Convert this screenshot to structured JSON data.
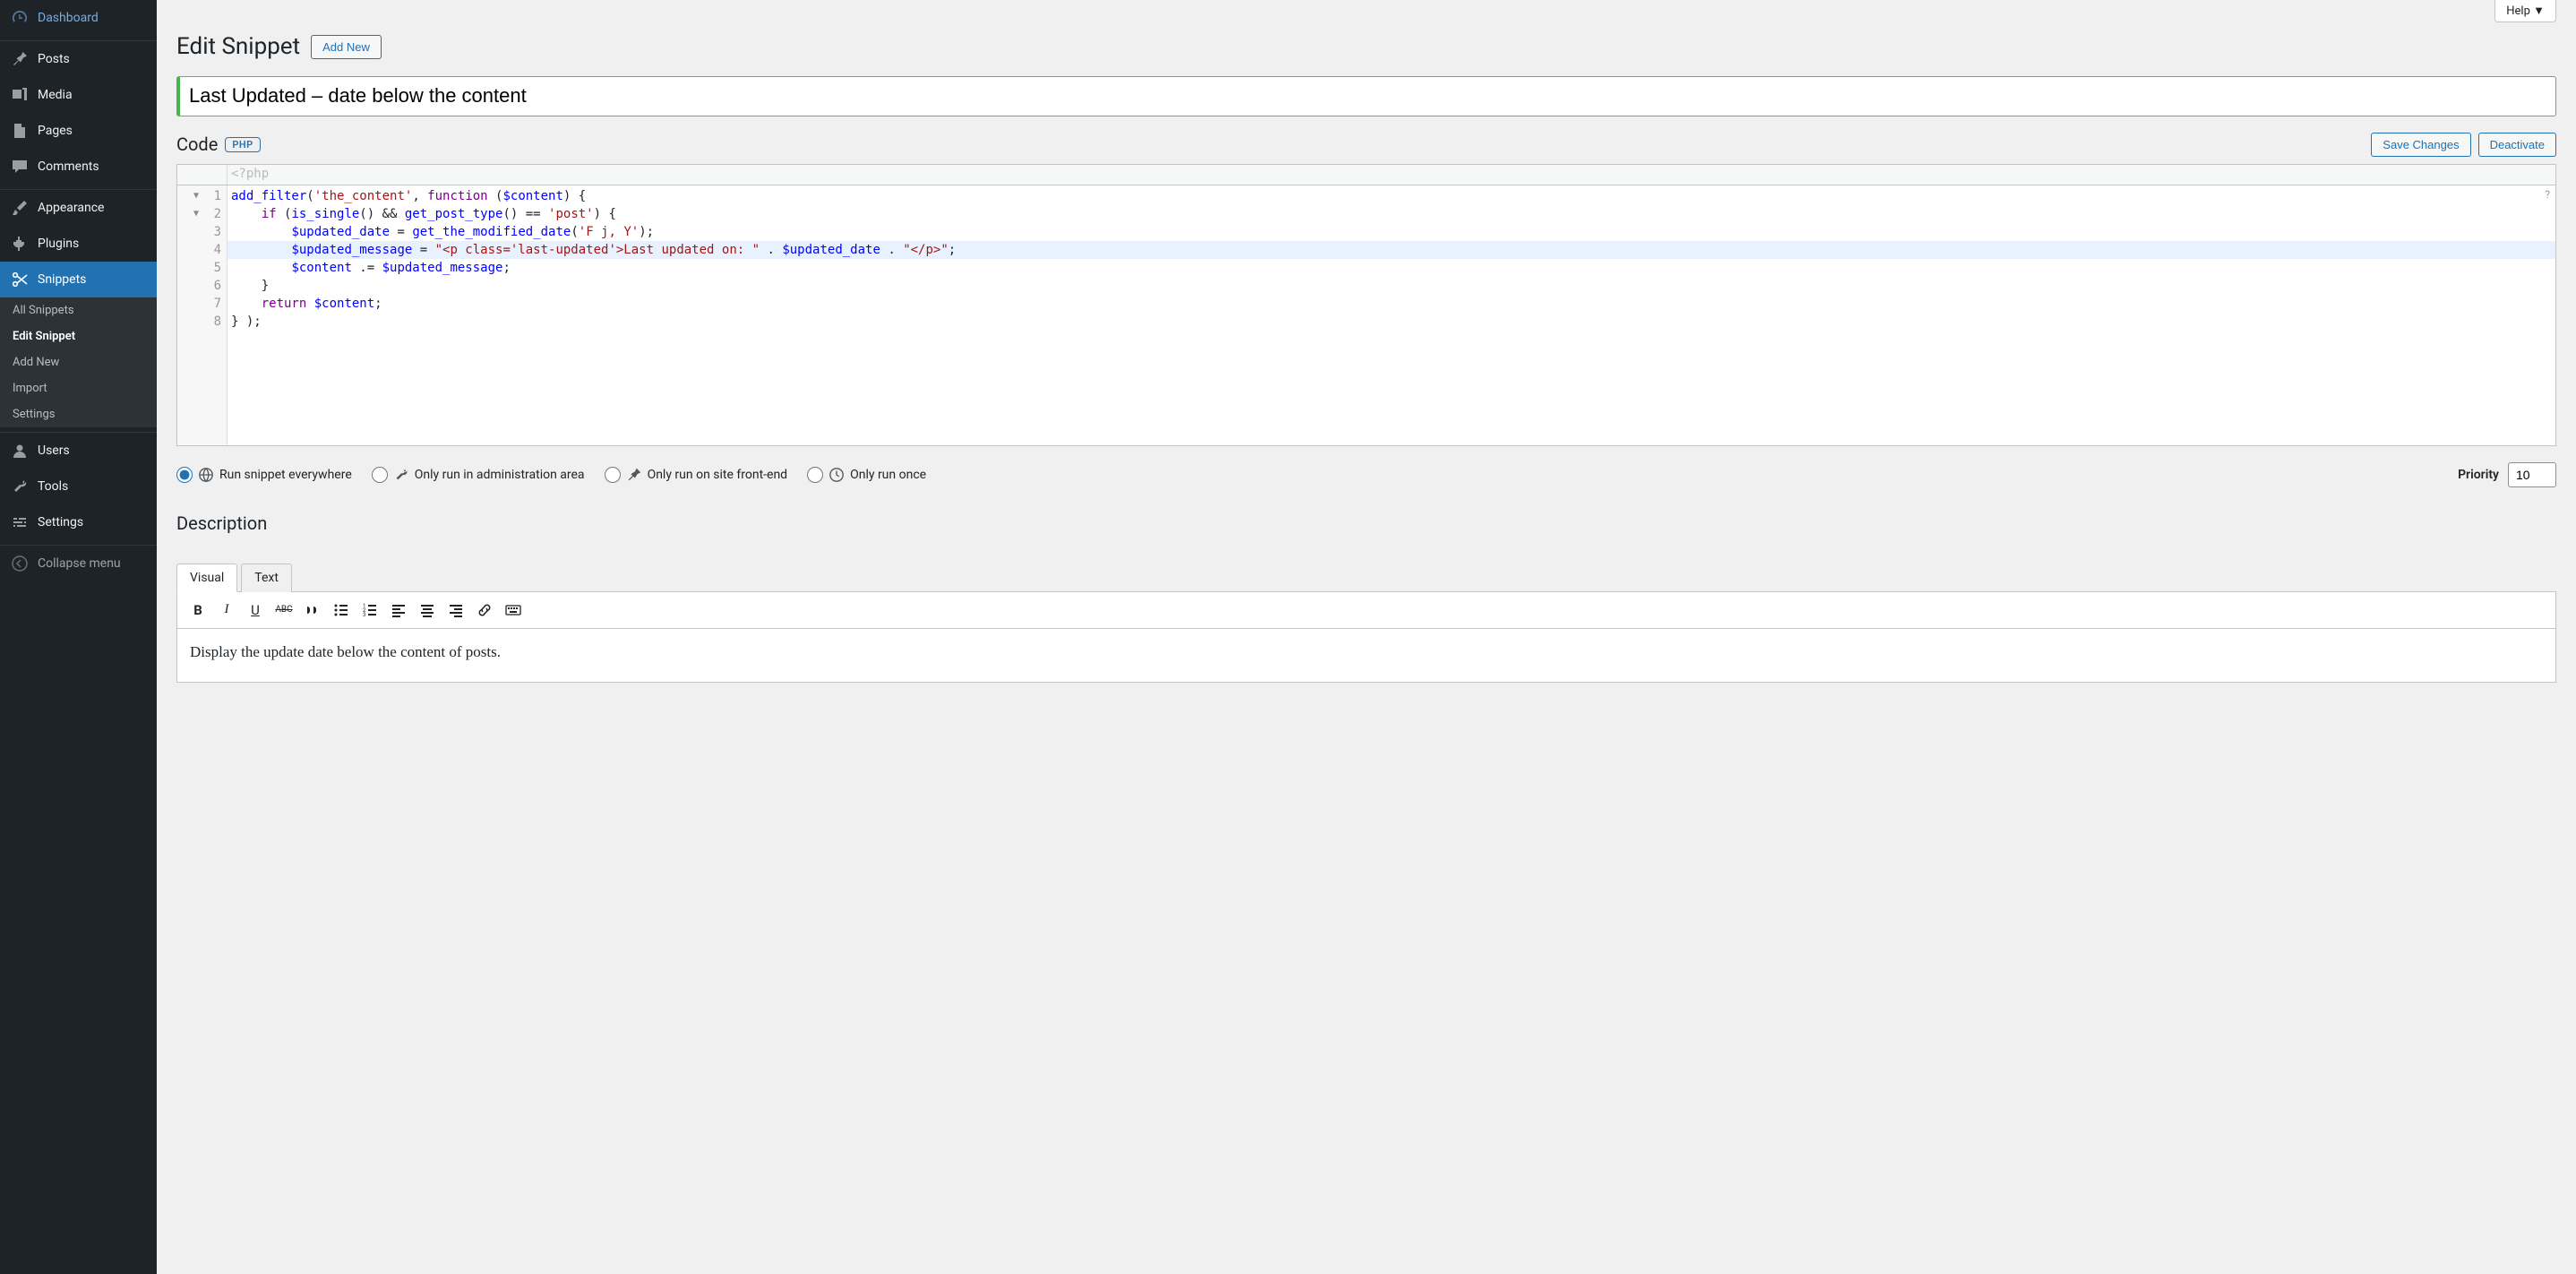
{
  "help_label": "Help ▼",
  "page_title": "Edit Snippet",
  "add_new_label": "Add New",
  "snippet_title": "Last Updated – date below the content",
  "code_heading": "Code",
  "php_badge": "PHP",
  "save_label": "Save Changes",
  "deactivate_label": "Deactivate",
  "code_header": "<?php",
  "code_lines": {
    "l1": "add_filter('the_content', function ($content) {",
    "l2": "    if (is_single() && get_post_type() == 'post') {",
    "l3": "        $updated_date = get_the_modified_date('F j, Y');",
    "l4": "        $updated_message = \"<p class='last-updated'>Last updated on: \" . $updated_date . \"</p>\";",
    "l5": "        $content .= $updated_message;",
    "l6": "    }",
    "l7": "    return $content;",
    "l8": "} );"
  },
  "gutter": [
    "1",
    "2",
    "3",
    "4",
    "5",
    "6",
    "7",
    "8"
  ],
  "scopes": {
    "everywhere": "Run snippet everywhere",
    "admin": "Only run in administration area",
    "frontend": "Only run on site front-end",
    "once": "Only run once"
  },
  "priority_label": "Priority",
  "priority_value": "10",
  "desc_heading": "Description",
  "tabs": {
    "visual": "Visual",
    "text": "Text"
  },
  "description_text": "Display the update date below the content of posts.",
  "menu": {
    "dashboard": "Dashboard",
    "posts": "Posts",
    "media": "Media",
    "pages": "Pages",
    "comments": "Comments",
    "appearance": "Appearance",
    "plugins": "Plugins",
    "snippets": "Snippets",
    "users": "Users",
    "tools": "Tools",
    "settings": "Settings",
    "collapse": "Collapse menu"
  },
  "submenu": {
    "all": "All Snippets",
    "edit": "Edit Snippet",
    "add": "Add New",
    "import": "Import",
    "settings": "Settings"
  }
}
